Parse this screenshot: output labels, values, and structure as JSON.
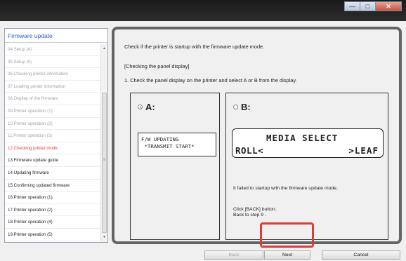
{
  "window": {
    "min_label": "—",
    "max_label": "□",
    "close_label": "✕"
  },
  "sidebar": {
    "title": "Firmware update",
    "items": [
      {
        "label": "04.Setup (4)"
      },
      {
        "label": "05.Setup (5)"
      },
      {
        "label": "06.Checking printer information"
      },
      {
        "label": "07.Loading printer information"
      },
      {
        "label": "08.Display of the firmware"
      },
      {
        "label": "09.Printer operation (1)"
      },
      {
        "label": "10.Printer operation (2)"
      },
      {
        "label": "11.Printer operation (3)"
      },
      {
        "label": "12.Checking printer mode"
      },
      {
        "label": "13.Firmware update guide"
      },
      {
        "label": "14.Updating firmware"
      },
      {
        "label": "15.Confirming updated firmware"
      },
      {
        "label": "16.Printer operation (1)"
      },
      {
        "label": "17.Printer operation (2)"
      },
      {
        "label": "18.Printer operation (4)"
      },
      {
        "label": "19.Printer operation (5)"
      }
    ],
    "scroll_up": "▲",
    "scroll_down": "▼",
    "scroll_grip": "≡"
  },
  "main": {
    "intro": "Check if the printer is startup with the firmware update mode.",
    "section": "[Checking the panel display]",
    "instruction": "1.  Check the panel display on the printer and select A or B from the display.",
    "option_a": {
      "label": "A:",
      "lcd_line1": "F/W UPDATING",
      "lcd_line2": " *TRANSMIT START*"
    },
    "option_b": {
      "label": "B:",
      "lcd_line1": "MEDIA SELECT",
      "lcd_left": "ROLL<",
      "lcd_right": ">LEAF",
      "message": "It failed to startup with the firmware update mode.",
      "click": "Click [BACK] button.",
      "back_to": "Back to step 9 ."
    }
  },
  "buttons": {
    "back": "Back",
    "next": "Next",
    "cancel": "Cancel"
  },
  "colors": {
    "active_item": "#e53935",
    "link": "#2a5bd7",
    "highlight": "#e53935"
  }
}
